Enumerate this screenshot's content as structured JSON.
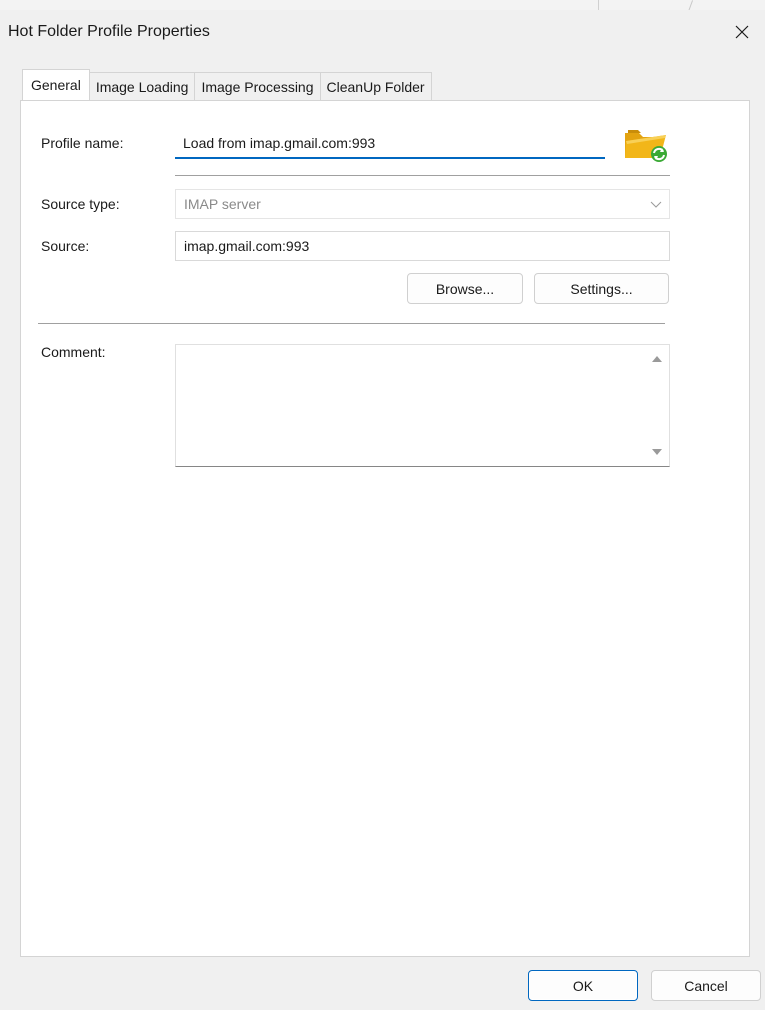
{
  "window": {
    "title": "Hot Folder Profile Properties",
    "close_label": "✕"
  },
  "tabs": [
    {
      "label": "General",
      "active": true
    },
    {
      "label": "Image Loading",
      "active": false
    },
    {
      "label": "Image Processing",
      "active": false
    },
    {
      "label": "CleanUp Folder",
      "active": false
    }
  ],
  "general": {
    "profile_name_label": "Profile name:",
    "profile_name_value": "Load from imap.gmail.com:993",
    "source_type_label": "Source type:",
    "source_type_value": "IMAP server",
    "source_label": "Source:",
    "source_value": "imap.gmail.com:993",
    "browse_label": "Browse...",
    "settings_label": "Settings...",
    "comment_label": "Comment:",
    "comment_value": ""
  },
  "footer": {
    "ok_label": "OK",
    "cancel_label": "Cancel"
  },
  "colors": {
    "accent": "#0067c0",
    "folder_yellow": "#f2b619",
    "refresh_green": "#3aa935"
  }
}
